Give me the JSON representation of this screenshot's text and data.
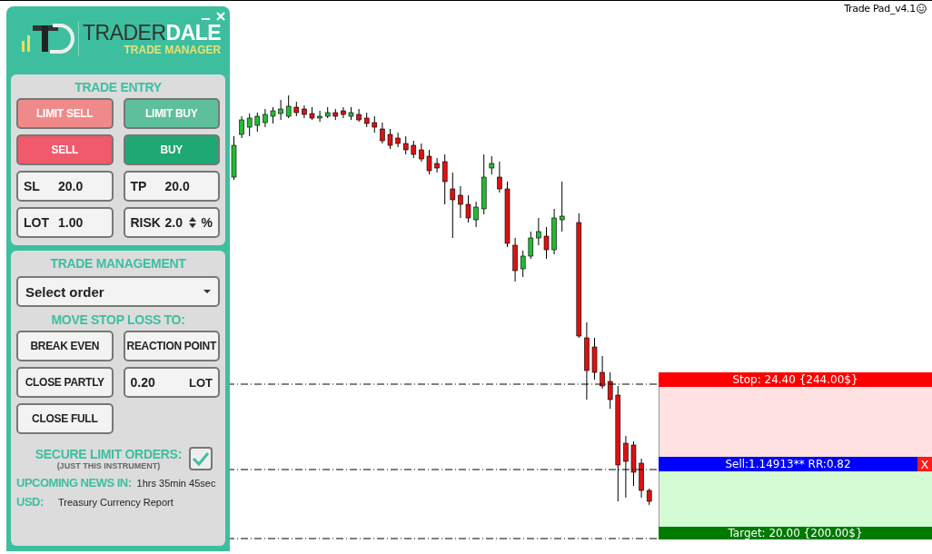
{
  "app_title": "Trade Pad_v4.1",
  "panel": {
    "logo": {
      "brand_dark": "TRADER",
      "brand_light": "DALE",
      "subtitle": "TRADE MANAGER"
    },
    "trade_entry": {
      "title": "TRADE ENTRY",
      "buttons": [
        {
          "label": "LIMIT SELL",
          "kind": "limit_sell"
        },
        {
          "label": "LIMIT BUY",
          "kind": "limit_buy"
        },
        {
          "label": "SELL",
          "kind": "sell"
        },
        {
          "label": "BUY",
          "kind": "buy"
        }
      ],
      "fields": [
        {
          "label": "SL",
          "value": "20.0",
          "kind": "plain"
        },
        {
          "label": "TP",
          "value": "20.0",
          "kind": "plain"
        },
        {
          "label": "LOT",
          "value": "1.00",
          "kind": "plain"
        },
        {
          "label": "RISK",
          "value": "2.0",
          "unit": "%",
          "kind": "spinner"
        }
      ]
    },
    "trade_management": {
      "title": "TRADE MANAGEMENT",
      "order_select": {
        "value": "Select order"
      },
      "move_stop_title": "MOVE STOP LOSS TO:",
      "buttons": [
        {
          "label": "BREAK EVEN",
          "kind": "button"
        },
        {
          "label": "REACTION POINT",
          "kind": "button"
        },
        {
          "label": "CLOSE PARTLY",
          "kind": "button"
        },
        {
          "value": "0.20",
          "unit": "LOT",
          "kind": "lot_field"
        },
        {
          "label": "CLOSE FULL",
          "kind": "button"
        }
      ],
      "secure": {
        "label": "SECURE LIMIT ORDERS:",
        "note": "(JUST THIS INSTRUMENT)",
        "checked": true
      },
      "news": {
        "label": "UPCOMING NEWS IN:",
        "countdown": "1hrs 35min 45sec",
        "currency": "USD:",
        "event": "Treasury Currency Report"
      }
    }
  },
  "position": {
    "stop": "Stop: 24.40 {244.00$}",
    "entry": "Sell:1.14913** RR:0.82",
    "close": "X",
    "target": "Target: 20.00 {200.00$}"
  }
}
